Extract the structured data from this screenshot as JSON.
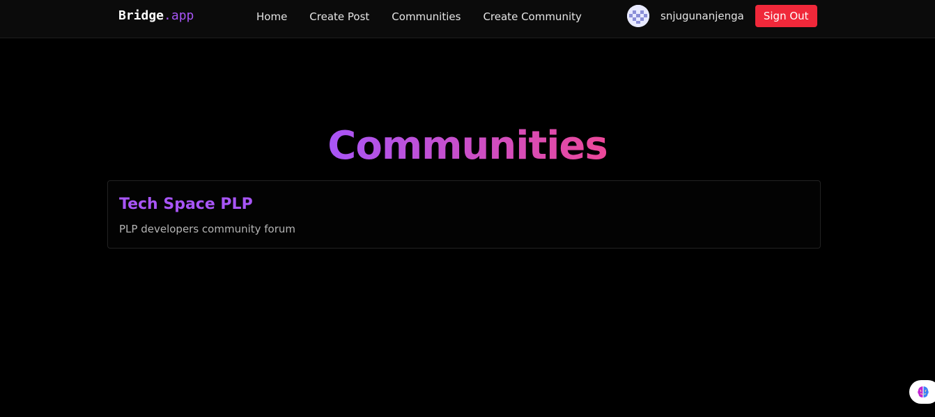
{
  "navbar": {
    "logo": {
      "primary": "Bridge",
      "accent": ".app"
    },
    "links": [
      {
        "label": "Home",
        "name": "nav-link-home"
      },
      {
        "label": "Create Post",
        "name": "nav-link-create-post"
      },
      {
        "label": "Communities",
        "name": "nav-link-communities"
      },
      {
        "label": "Create Community",
        "name": "nav-link-create-community"
      }
    ],
    "user": {
      "avatar_icon": "pixel-identicon-avatar",
      "username": "snjugunanjenga"
    },
    "sign_out_label": "Sign Out"
  },
  "main": {
    "title": "Communities",
    "communities": [
      {
        "name": "Tech Space PLP",
        "description": "PLP developers community forum"
      }
    ]
  },
  "widget": {
    "icon": "brain-icon"
  },
  "colors": {
    "background": "#000000",
    "navbar": "#0b0b0b",
    "accent_purple": "#a855f7",
    "accent_pink": "#ec4899",
    "sign_out": "#f0283a"
  }
}
